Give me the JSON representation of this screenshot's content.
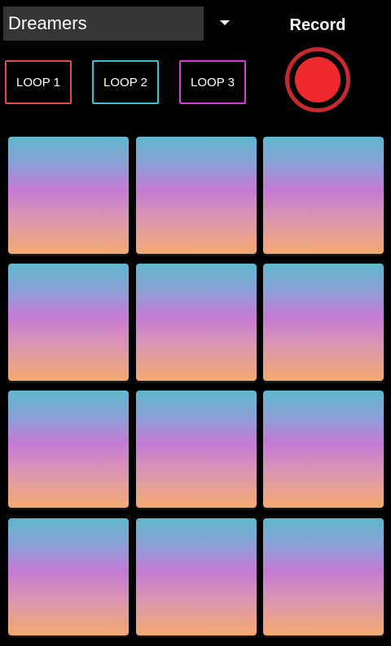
{
  "header": {
    "preset_value": "Dreamers",
    "record_label": "Record"
  },
  "loops": [
    {
      "label": "LOOP 1",
      "color": "#e04a4a"
    },
    {
      "label": "LOOP 2",
      "color": "#3cc0d8"
    },
    {
      "label": "LOOP 3",
      "color": "#d43ad8"
    }
  ],
  "pads": {
    "rows": 4,
    "columns": 3,
    "gradient_colors": [
      "#5eb7cc",
      "#c47ad4",
      "#f5aa70"
    ]
  },
  "colors": {
    "background": "#000000",
    "record": "#ef2a2e"
  }
}
